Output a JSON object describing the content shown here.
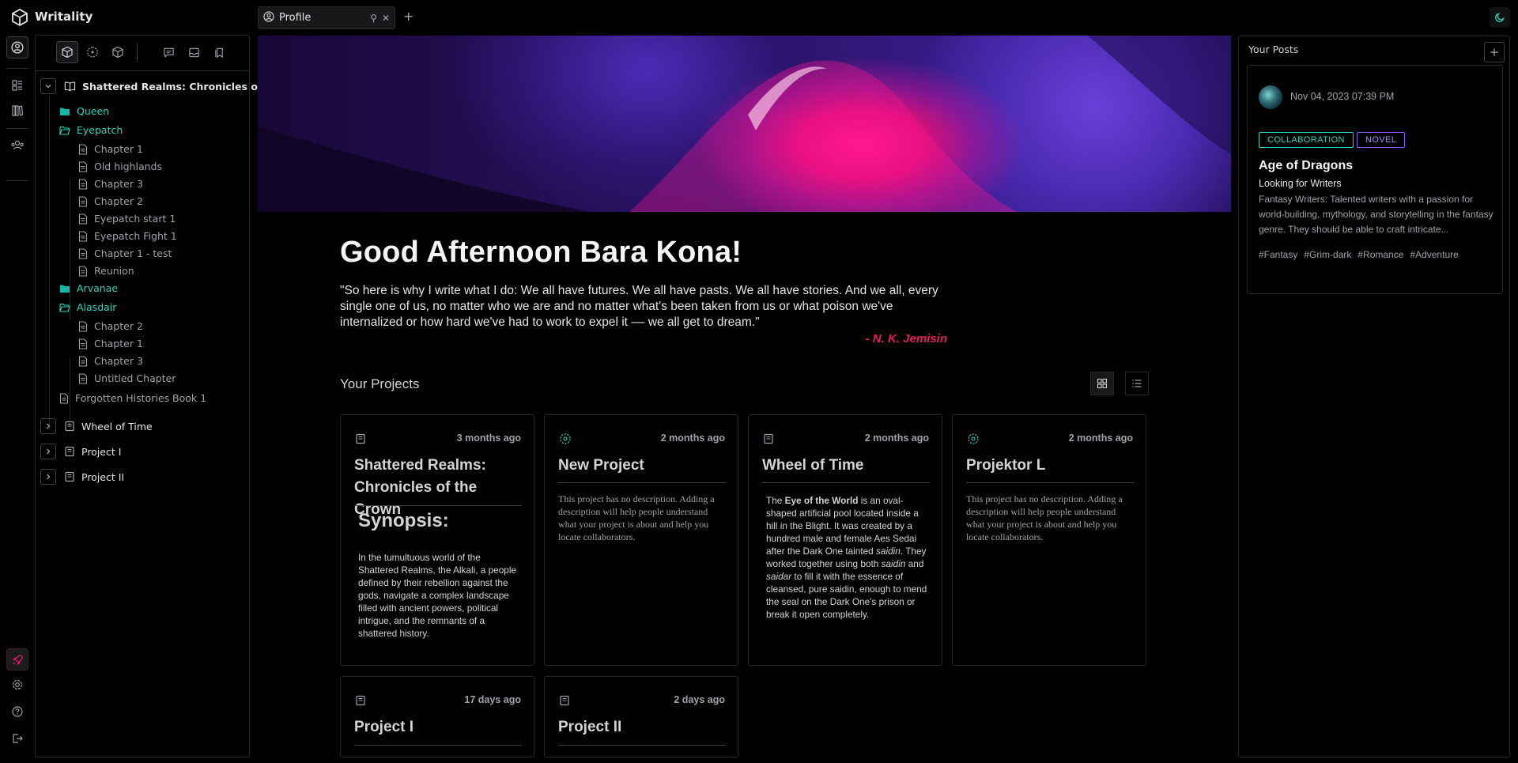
{
  "app": {
    "title": "Writality"
  },
  "tabs": [
    {
      "label": "Profile"
    }
  ],
  "explorer": {
    "root": "Shattered Realms: Chronicles o...",
    "tree": [
      {
        "type": "folder",
        "label": "Queen"
      },
      {
        "type": "folder-open",
        "label": "Eyepatch"
      },
      {
        "type": "file",
        "label": "Chapter 1"
      },
      {
        "type": "file",
        "label": "Old highlands"
      },
      {
        "type": "file",
        "label": "Chapter 3"
      },
      {
        "type": "file",
        "label": "Chapter 2"
      },
      {
        "type": "file",
        "label": "Eyepatch start 1"
      },
      {
        "type": "file",
        "label": "Eyepatch Fight 1"
      },
      {
        "type": "file",
        "label": "Chapter 1 - test"
      },
      {
        "type": "file",
        "label": "Reunion"
      },
      {
        "type": "folder",
        "label": "Arvanae"
      },
      {
        "type": "folder-open",
        "label": "Alasdair"
      },
      {
        "type": "file",
        "label": "Chapter 2"
      },
      {
        "type": "file",
        "label": "Chapter 1"
      },
      {
        "type": "file",
        "label": "Chapter 3"
      },
      {
        "type": "file",
        "label": "Untitled Chapter"
      },
      {
        "type": "file-root",
        "label": "Forgotten Histories Book 1"
      }
    ],
    "projects": [
      "Wheel of Time",
      "Project I",
      "Project II"
    ]
  },
  "main": {
    "greeting": "Good Afternoon Bara Kona!",
    "quote": "\"So here is why I write what I do: We all have futures. We all have pasts. We all have stories. And we all, every single one of us, no matter who we are and no matter what's been taken from us or what poison we've internalized or how hard we've had to work to expel it –– we all get to dream.\"",
    "quote_author": "- N. K. Jemisin",
    "projects_title": "Your Projects",
    "no_description": "This project has no description. Adding a description will help people understand what your project is about and help you locate collaborators.",
    "cards": [
      {
        "title": "Shattered Realms: Chronicles of the Crown",
        "time": "3 months ago",
        "icon": "book-icon",
        "synopsis_heading": "Synopsis:",
        "synopsis": "In the tumultuous world of the Shattered Realms, the Alkali, a people defined by their rebellion against the gods, navigate a complex landscape filled with ancient powers, political intrigue, and the remnants of a shattered history."
      },
      {
        "title": "New Project",
        "time": "2 months ago",
        "icon": "collab-icon"
      },
      {
        "title": "Wheel of Time",
        "time": "2 months ago",
        "icon": "book-icon",
        "body_pre": "The ",
        "body_bold": "Eye of the World",
        "body_mid": " is an oval-shaped artificial pool located inside a hill in the Blight. It was created by a hundred male and female Aes Sedai after the Dark One tainted ",
        "body_em1": "saidin",
        "body_mid2": ". They worked together using both ",
        "body_em2": "saidin",
        "body_and": " and ",
        "body_em3": "saidar",
        "body_post": " to fill it with the essence of cleansed, pure saidin, enough to mend the seal on the Dark One's prison or break it open completely."
      },
      {
        "title": "Projektor L",
        "time": "2 months ago",
        "icon": "collab-icon"
      },
      {
        "title": "Project I",
        "time": "17 days ago",
        "icon": "book-icon"
      },
      {
        "title": "Project II",
        "time": "2 days ago",
        "icon": "book-icon"
      }
    ]
  },
  "posts": {
    "title": "Your Posts",
    "items": [
      {
        "date": "Nov 04, 2023 07:39 PM",
        "tags": [
          "COLLABORATION",
          "NOVEL"
        ],
        "title": "Age of Dragons",
        "subtitle": "Looking for Writers",
        "description": "Fantasy Writers: Talented writers with a passion for world-building, mythology, and storytelling in the fantasy genre. They should be able to craft intricate...",
        "hashtags": [
          "#Fantasy",
          "#Grim-dark",
          "#Romance",
          "#Adventure"
        ]
      }
    ]
  },
  "colors": {
    "accent": "#2dd4bf",
    "quote_author": "#e11d62",
    "novel_tag": "#a78bfa"
  }
}
